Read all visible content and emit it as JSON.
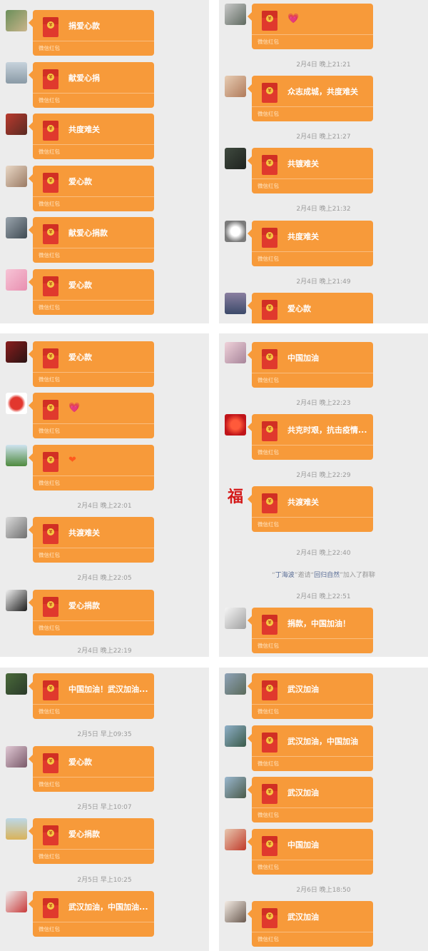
{
  "label": "微信红包",
  "times": {
    "t1": "2月4日 晚上21:21",
    "t2": "2月4日 晚上21:27",
    "t3": "2月4日 晚上21:32",
    "t4": "2月4日 晚上21:49",
    "t5": "2月4日 晚上22:01",
    "t6": "2月4日 晚上22:05",
    "t7": "2月4日 晚上22:19",
    "t8": "2月4日 晚上22:23",
    "t9": "2月4日 晚上22:29",
    "t10": "2月4日 晚上22:40",
    "t11": "2月4日 晚上22:51",
    "t12": "2月5日 早上09:35",
    "t13": "2月5日 早上10:07",
    "t14": "2月5日 早上10:25",
    "t15": "2月6日 晚上18:50"
  },
  "system_notice": {
    "inviter": "丁海波",
    "verb": "邀请",
    "invitee": "回归自然",
    "suffix": "加入了群聊"
  },
  "messages": {
    "p1": [
      "捐爱心款",
      "献爱心捐",
      "共度难关",
      "爱心款",
      "献爱心捐款",
      "爱心款"
    ],
    "p2": [
      "",
      "众志成城，共度难关",
      "共镀难关",
      "共度难关",
      "爱心款"
    ],
    "p3": [
      "爱心款",
      "",
      "",
      "共渡难关",
      "爱心捐款"
    ],
    "p4": [
      "中国加油",
      "共克时艰，抗击疫情...",
      "共渡难关",
      "捐款，中国加油！"
    ],
    "p5": [
      "中国加油！武汉加油...",
      "爱心款",
      "爱心捐款",
      "武汉加油，中国加油..."
    ],
    "p6": [
      "武汉加油",
      "武汉加油，中国加油",
      "武汉加油",
      "中国加油",
      "武汉加油"
    ]
  },
  "emoji": {
    "pink_heart": "💗",
    "orange_heart": "❤"
  },
  "colors": {
    "panel_bg": "#ececec",
    "bubble": "#f79a3a",
    "envelope": "#e0392d",
    "time_text": "#9a9a9a",
    "name_link": "#576b95"
  }
}
